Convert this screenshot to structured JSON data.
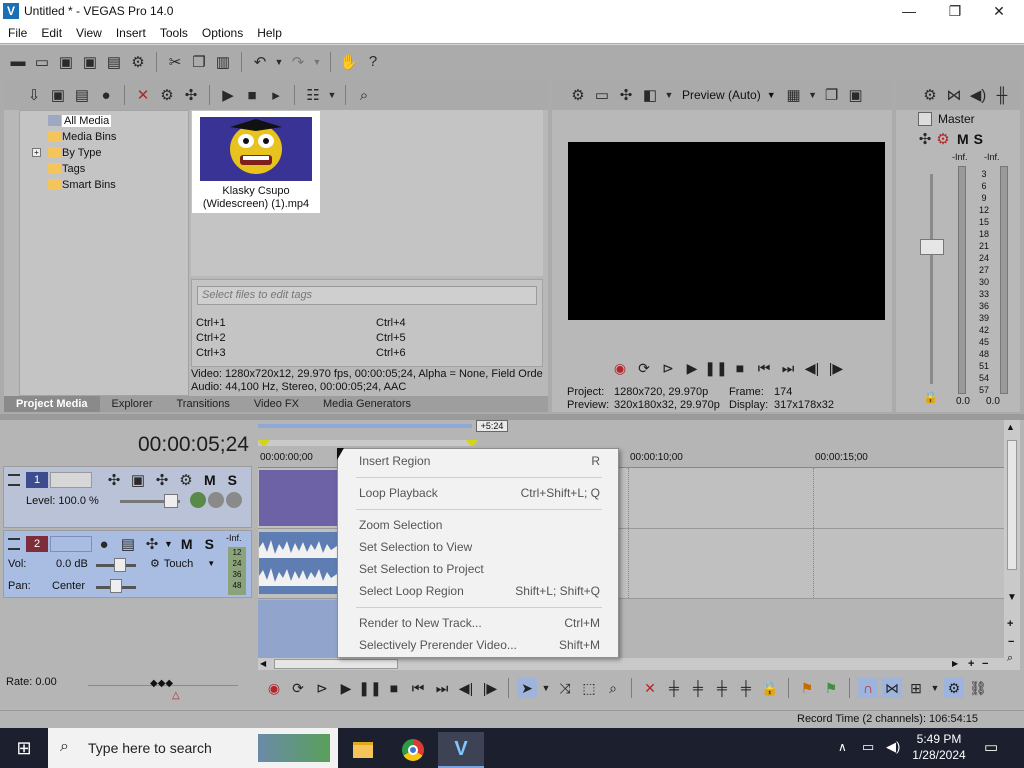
{
  "window": {
    "title": "Untitled * - VEGAS Pro 14.0",
    "logo_letter": "V",
    "minimize": "—",
    "maximize": "❐",
    "close": "✕"
  },
  "menu": [
    "File",
    "Edit",
    "View",
    "Insert",
    "Tools",
    "Options",
    "Help"
  ],
  "media_panel": {
    "tree": [
      "All Media",
      "Media Bins",
      "By Type",
      "Tags",
      "Smart Bins"
    ],
    "tree_expander": "+",
    "media_file_line1": "Klasky Csupo",
    "media_file_line2": "(Widescreen) (1).mp4",
    "tag_placeholder": "Select files to edit tags",
    "shortcuts": [
      "Ctrl+1",
      "Ctrl+2",
      "Ctrl+3",
      "Ctrl+4",
      "Ctrl+5",
      "Ctrl+6"
    ],
    "info_video": "Video: 1280x720x12, 29.970 fps, 00:00:05;24, Alpha = None, Field Orde",
    "info_audio": "Audio: 44,100 Hz, Stereo, 00:00:05;24, AAC"
  },
  "panel_tabs": [
    "Project Media",
    "Explorer",
    "Transitions",
    "Video FX",
    "Media Generators"
  ],
  "preview": {
    "mode": "Preview (Auto)",
    "project_label": "Project:",
    "project_value": "1280x720, 29.970p",
    "preview_label": "Preview:",
    "preview_value": "320x180x32, 29.970p",
    "frame_label": "Frame:",
    "frame_value": "174",
    "display_label": "Display:",
    "display_value": "317x178x32"
  },
  "master": {
    "title": "Master",
    "m": "M",
    "s": "S",
    "inf_left": "-Inf.",
    "inf_right": "-Inf.",
    "scale": [
      "3",
      "6",
      "9",
      "12",
      "15",
      "18",
      "21",
      "24",
      "27",
      "30",
      "33",
      "36",
      "39",
      "42",
      "45",
      "48",
      "51",
      "54",
      "57"
    ],
    "bottom_left": "0.0",
    "bottom_right": "0.0"
  },
  "timeline": {
    "time": "00:00:05;24",
    "region_tag": "+5:24",
    "ruler": [
      "00:00:00;00",
      "00:00:10;00",
      "00:00:15;00"
    ],
    "video_track": {
      "number": "1",
      "level_label": "Level: 100.0 %",
      "m": "M",
      "s": "S"
    },
    "audio_track": {
      "number": "2",
      "vol_label": "Vol:",
      "vol_value": "0.0 dB",
      "pan_label": "Pan:",
      "pan_value": "Center",
      "touch": "Touch",
      "m": "M",
      "s": "S",
      "meter_inf": "-Inf.",
      "meter_scale": [
        "12",
        "24",
        "36",
        "48"
      ]
    }
  },
  "context_menu": [
    {
      "label": "Insert Region",
      "shortcut": "R"
    },
    {
      "label": "Loop Playback",
      "shortcut": "Ctrl+Shift+L; Q"
    },
    {
      "label": "Zoom Selection",
      "shortcut": ""
    },
    {
      "label": "Set Selection to View",
      "shortcut": ""
    },
    {
      "label": "Set Selection to Project",
      "shortcut": ""
    },
    {
      "label": "Select Loop Region",
      "shortcut": "Shift+L; Shift+Q"
    },
    {
      "label": "Render to New Track...",
      "shortcut": "Ctrl+M"
    },
    {
      "label": "Selectively Prerender Video...",
      "shortcut": "Shift+M"
    }
  ],
  "bottom": {
    "rate": "Rate: 0.00",
    "record_time": "Record Time (2 channels): 106:54:15"
  },
  "taskbar": {
    "search_placeholder": "Type here to search",
    "time": "5:49 PM",
    "date": "1/28/2024"
  }
}
